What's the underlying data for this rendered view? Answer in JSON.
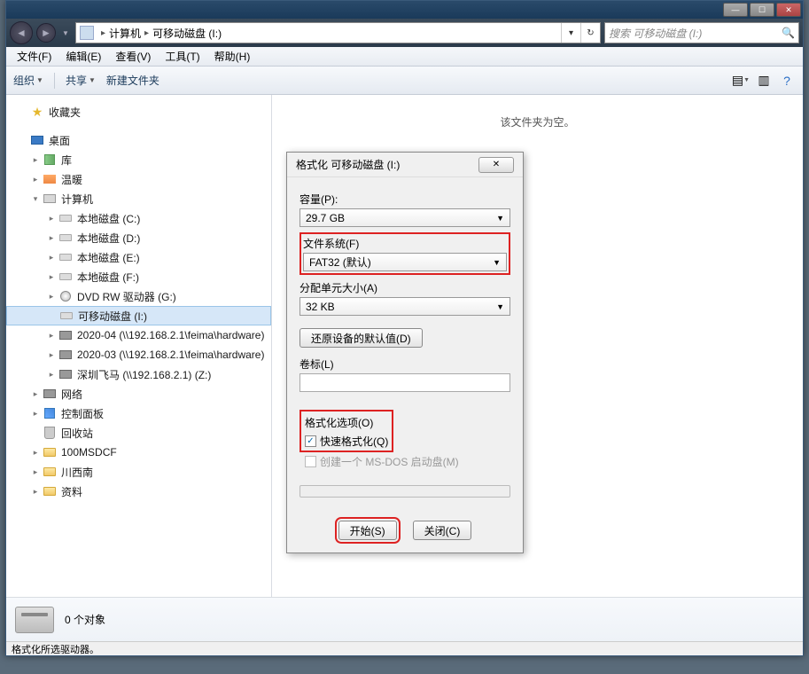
{
  "titlebar": {},
  "nav": {
    "breadcrumb": [
      "计算机",
      "可移动磁盘 (I:)"
    ],
    "search_placeholder": "搜索 可移动磁盘 (I:)"
  },
  "menubar": [
    "文件(F)",
    "编辑(E)",
    "查看(V)",
    "工具(T)",
    "帮助(H)"
  ],
  "toolbar": {
    "organize": "组织",
    "share": "共享",
    "new_folder": "新建文件夹"
  },
  "sidebar": {
    "favorites": "收藏夹",
    "desktop": "桌面",
    "libraries": "库",
    "warm": "温暖",
    "computer": "计算机",
    "drives": [
      "本地磁盘 (C:)",
      "本地磁盘 (D:)",
      "本地磁盘 (E:)",
      "本地磁盘 (F:)",
      "DVD RW 驱动器 (G:)",
      "可移动磁盘 (I:)",
      "2020-04 (\\\\192.168.2.1\\feima\\hardware)",
      "2020-03 (\\\\192.168.2.1\\feima\\hardware)",
      "深圳飞马 (\\\\192.168.2.1) (Z:)"
    ],
    "network": "网络",
    "cpanel": "控制面板",
    "recycle": "回收站",
    "folders": [
      "100MSDCF",
      "川西南",
      "资料"
    ]
  },
  "main": {
    "empty": "该文件夹为空。"
  },
  "dialog": {
    "title": "格式化 可移动磁盘 (I:)",
    "capacity_label": "容量(P):",
    "capacity_value": "29.7 GB",
    "fs_label": "文件系统(F)",
    "fs_value": "FAT32 (默认)",
    "alloc_label": "分配单元大小(A)",
    "alloc_value": "32 KB",
    "restore": "还原设备的默认值(D)",
    "volume_label": "卷标(L)",
    "volume_value": "",
    "options_label": "格式化选项(O)",
    "quick_label": "快速格式化(Q)",
    "msdos_label": "创建一个 MS-DOS 启动盘(M)",
    "start": "开始(S)",
    "close": "关闭(C)"
  },
  "details": {
    "count": "0 个对象"
  },
  "status": "格式化所选驱动器。"
}
